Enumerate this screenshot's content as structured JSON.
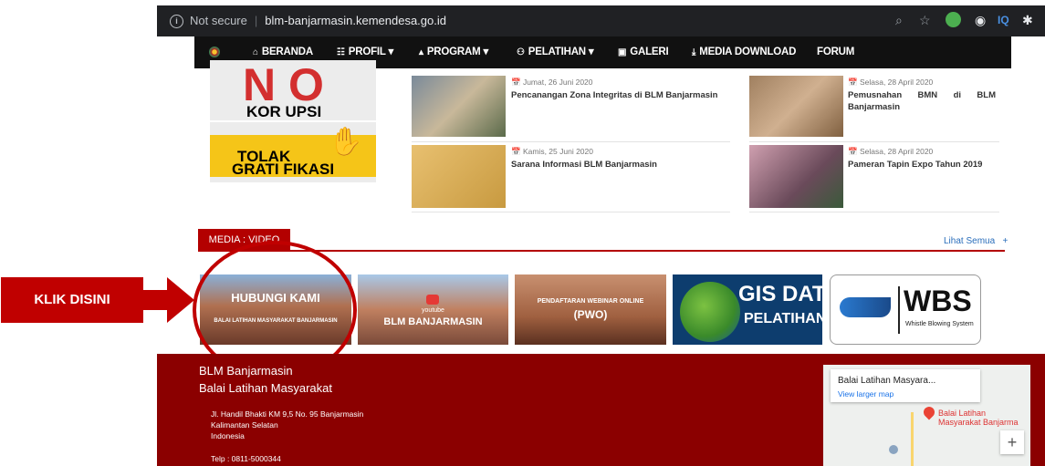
{
  "browser": {
    "security_label": "Not secure",
    "url": "blm-banjarmasin.kemendesa.go.id",
    "info_icon": "info-icon",
    "iq_label": "IQ"
  },
  "nav": {
    "items": [
      {
        "icon": "home-icon",
        "glyph": "⌂",
        "label": "BERANDA"
      },
      {
        "icon": "sitemap-icon",
        "glyph": "☷",
        "label": "PROFIL ▾"
      },
      {
        "icon": "bank-icon",
        "glyph": "⌂",
        "label": "PROGRAM ▾"
      },
      {
        "icon": "users-icon",
        "glyph": "⚇",
        "label": "PELATIHAN ▾"
      },
      {
        "icon": "camera-icon",
        "glyph": "▣",
        "label": "GALERI"
      },
      {
        "icon": "download-icon",
        "glyph": "⭳",
        "label": "MEDIA DOWNLOAD"
      },
      {
        "icon": "",
        "glyph": "",
        "label": "FORUM"
      }
    ]
  },
  "banners": {
    "korupsi": {
      "left": "N",
      "right": "O",
      "text": "KOR UPSI"
    },
    "gratifikasi": {
      "line1": "TOLAK",
      "line2": "GRATI FIKASI"
    }
  },
  "news": [
    {
      "date": "Jumat, 26 Juni 2020",
      "title": "Pencanangan Zona Integritas di BLM Banjarmasin"
    },
    {
      "date": "Selasa, 28 April 2020",
      "title": "Pemusnahan BMN di BLM Banjarmasin"
    },
    {
      "date": "Kamis, 25 Juni 2020",
      "title": "Sarana Informasi BLM Banjarmasin"
    },
    {
      "date": "Selasa, 28 April 2020",
      "title": "Pameran Tapin Expo Tahun 2019"
    }
  ],
  "media": {
    "tab": "MEDIA : VIDEO",
    "see_all": "Lihat Semua",
    "see_all_plus": "+",
    "videos": [
      {
        "title": "HUBUNGI KAMI",
        "sub": "BALAI LATIHAN MASYARAKAT BANJARMASIN"
      },
      {
        "title": "BLM BANJARMASIN",
        "sub": "youtube"
      },
      {
        "title": "(PWO)",
        "sub": "PENDAFTARAN WEBINAR ONLINE"
      },
      {
        "title": "PELATIHAN",
        "sub": "GIS DATA"
      },
      {
        "title": "WBS",
        "sub": "Whistle Blowing System"
      }
    ]
  },
  "annotation": {
    "label": "KLIK DISINI",
    "color": "#c00000"
  },
  "footer": {
    "org1": "BLM Banjarmasin",
    "org2": "Balai Latihan Masyarakat",
    "addr1": "Jl. Handil Bhakti KM 9,5 No. 95 Banjarmasin",
    "addr2": "Kalimantan Selatan",
    "addr3": "Indonesia",
    "phone": "Telp : 0811-5000344",
    "bg": "#8b0000"
  },
  "map": {
    "card_title": "Balai Latihan Masyara...",
    "card_link": "View larger map",
    "pin_label1": "Balai Latihan",
    "pin_label2": "Masyarakat Banjarma",
    "zoom_in": "+"
  }
}
